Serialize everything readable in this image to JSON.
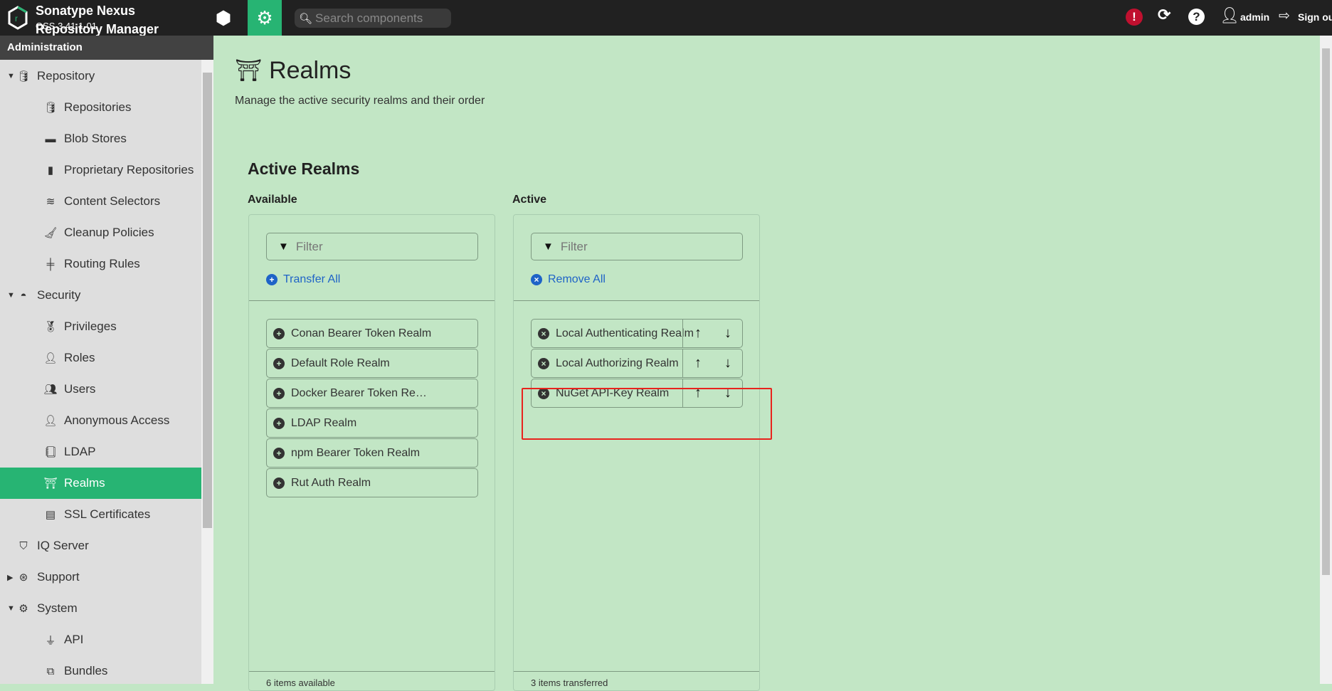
{
  "header": {
    "title": "Sonatype Nexus",
    "subtitle": "Repository Manager",
    "version": "OSS 3.41.1-01",
    "search_placeholder": "Search components",
    "user": "admin",
    "sign_out": "Sign out"
  },
  "sidebar": {
    "title": "Administration",
    "items": [
      {
        "label": "Repository",
        "level": 0,
        "expanded": true,
        "icon": "database-icon"
      },
      {
        "label": "Repositories",
        "level": 1,
        "icon": "database-icon"
      },
      {
        "label": "Blob Stores",
        "level": 1,
        "icon": "hdd-icon"
      },
      {
        "label": "Proprietary Repositories",
        "level": 1,
        "icon": "door-icon"
      },
      {
        "label": "Content Selectors",
        "level": 1,
        "icon": "layers-icon"
      },
      {
        "label": "Cleanup Policies",
        "level": 1,
        "icon": "broom-icon"
      },
      {
        "label": "Routing Rules",
        "level": 1,
        "icon": "signpost-icon"
      },
      {
        "label": "Security",
        "level": 0,
        "expanded": true,
        "icon": "police-cap-icon"
      },
      {
        "label": "Privileges",
        "level": 1,
        "icon": "medal-icon"
      },
      {
        "label": "Roles",
        "level": 1,
        "icon": "user-tag-icon"
      },
      {
        "label": "Users",
        "level": 1,
        "icon": "users-icon"
      },
      {
        "label": "Anonymous Access",
        "level": 1,
        "icon": "user-icon"
      },
      {
        "label": "LDAP",
        "level": 1,
        "icon": "address-book-icon"
      },
      {
        "label": "Realms",
        "level": 1,
        "selected": true,
        "icon": "archway-icon"
      },
      {
        "label": "SSL Certificates",
        "level": 1,
        "icon": "certificate-icon"
      },
      {
        "label": "IQ Server",
        "level": 0,
        "icon": "shield-icon"
      },
      {
        "label": "Support",
        "level": 0,
        "expanded": false,
        "icon": "lifebuoy-icon"
      },
      {
        "label": "System",
        "level": 0,
        "expanded": true,
        "icon": "gear-icon"
      },
      {
        "label": "API",
        "level": 1,
        "icon": "plug-icon"
      },
      {
        "label": "Bundles",
        "level": 1,
        "icon": "puzzle-icon"
      }
    ]
  },
  "page": {
    "title": "Realms",
    "description": "Manage the active security realms and their order",
    "section": "Active Realms",
    "available": {
      "label": "Available",
      "filter_placeholder": "Filter",
      "action": "Transfer All",
      "items": [
        "Conan Bearer Token Realm",
        "Default Role Realm",
        "Docker Bearer Token Realm",
        "LDAP Realm",
        "npm Bearer Token Realm",
        "Rut Auth Realm"
      ],
      "footer": "6 items available"
    },
    "active": {
      "label": "Active",
      "filter_placeholder": "Filter",
      "action": "Remove All",
      "items": [
        "Local Authenticating Realm",
        "Local Authorizing Realm",
        "NuGet API-Key Realm"
      ],
      "footer": "3 items transferred"
    }
  },
  "colors": {
    "accent": "#27b473",
    "highlight": "#e8231d",
    "background": "#c2e6c5"
  }
}
